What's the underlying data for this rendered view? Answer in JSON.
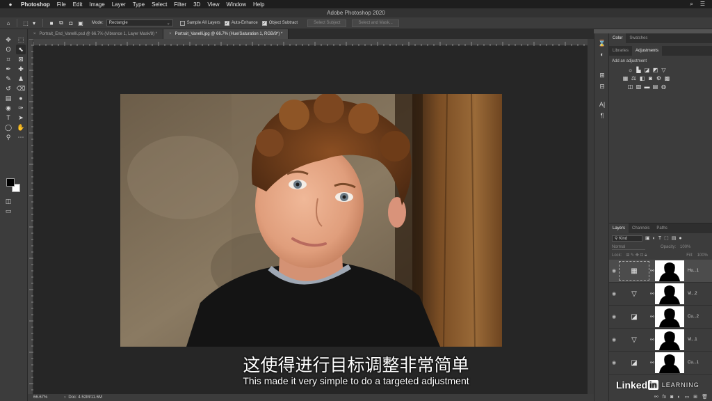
{
  "menubar": {
    "app": "Photoshop",
    "items": [
      "File",
      "Edit",
      "Image",
      "Layer",
      "Type",
      "Select",
      "Filter",
      "3D",
      "View",
      "Window",
      "Help"
    ]
  },
  "window": {
    "title": "Adobe Photoshop 2020"
  },
  "options": {
    "mode_label": "Mode:",
    "mode_value": "Rectangle",
    "sample_all_layers": "Sample All Layers",
    "auto_enhance": "Auto-Enhance",
    "object_subtract": "Object Subtract",
    "select_subject": "Select Subject",
    "select_and_mask": "Select and Mask..."
  },
  "tabs": [
    {
      "label": "Portrait_End_Vanelli.psd @ 66.7% (Vibrance 1, Layer Mask/8) *",
      "active": false
    },
    {
      "label": "Portrait_Vanelli.jpg @ 66.7% (Hue/Saturation 1, RGB/8*) *",
      "active": true
    }
  ],
  "status": {
    "zoom": "66.67%",
    "doc": "Doc: 4.52M/11.6M"
  },
  "right_panel": {
    "top_tabs": [
      "Color",
      "Swatches"
    ],
    "mid_tabs": [
      "Libraries",
      "Adjustments"
    ],
    "add_adjustment": "Add an adjustment",
    "layers_tabs": [
      "Layers",
      "Channels",
      "Paths"
    ],
    "kind_label": "Kind",
    "blend_mode": "Normal",
    "opacity_label": "Opacity:",
    "opacity_value": "100%",
    "lock_label": "Lock:",
    "fill_label": "Fill:",
    "fill_value": "100%"
  },
  "layers": [
    {
      "name": "Hu...1",
      "icon": "hue-saturation-icon",
      "glyph": "▦",
      "active": true
    },
    {
      "name": "Vi...2",
      "icon": "vibrance-icon",
      "glyph": "▽",
      "active": false
    },
    {
      "name": "Cu...2",
      "icon": "curves-icon",
      "glyph": "◪",
      "active": false
    },
    {
      "name": "Vi...1",
      "icon": "vibrance-icon",
      "glyph": "▽",
      "active": false
    },
    {
      "name": "Cu...1",
      "icon": "curves-icon",
      "glyph": "◪",
      "active": false
    }
  ],
  "subtitles": {
    "cn": "这使得进行目标调整非常简单",
    "en": "This made it very simple to do a targeted adjustment"
  },
  "watermark": {
    "linked": "Linked",
    "in": "in",
    "learning": "LEARNING"
  }
}
